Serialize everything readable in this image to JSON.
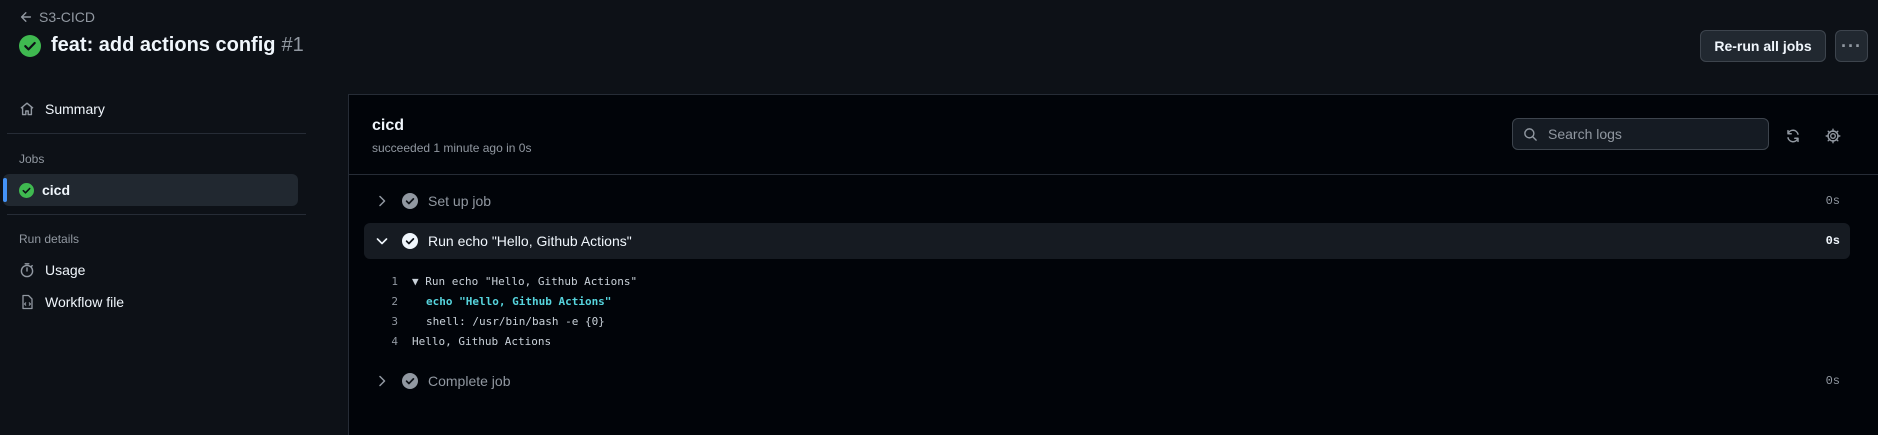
{
  "header": {
    "back_label": "S3-CICD",
    "title": "feat: add actions config",
    "run_number": "#1",
    "rerun_label": "Re-run all jobs",
    "more_label": "···"
  },
  "sidebar": {
    "summary_label": "Summary",
    "jobs_heading": "Jobs",
    "job_label": "cicd",
    "run_details_heading": "Run details",
    "usage_label": "Usage",
    "workflow_file_label": "Workflow file"
  },
  "job": {
    "name": "cicd",
    "status": "succeeded 1 minute ago in 0s",
    "search_placeholder": "Search logs"
  },
  "steps": [
    {
      "name": "Set up job",
      "duration": "0s",
      "expanded": false
    },
    {
      "name": "Run echo \"Hello, Github Actions\"",
      "duration": "0s",
      "expanded": true
    },
    {
      "name": "Complete job",
      "duration": "0s",
      "expanded": false
    }
  ],
  "log_lines": [
    {
      "num": "1",
      "text": "▼ Run echo \"Hello, Github Actions\""
    },
    {
      "num": "2",
      "text": "echo \"Hello, Github Actions\""
    },
    {
      "num": "3",
      "text": "shell: /usr/bin/bash -e {0}"
    },
    {
      "num": "4",
      "text": "Hello, Github Actions"
    }
  ],
  "colors": {
    "success": "#3fb950",
    "accent": "#4493f8",
    "background": "#0d1117"
  }
}
